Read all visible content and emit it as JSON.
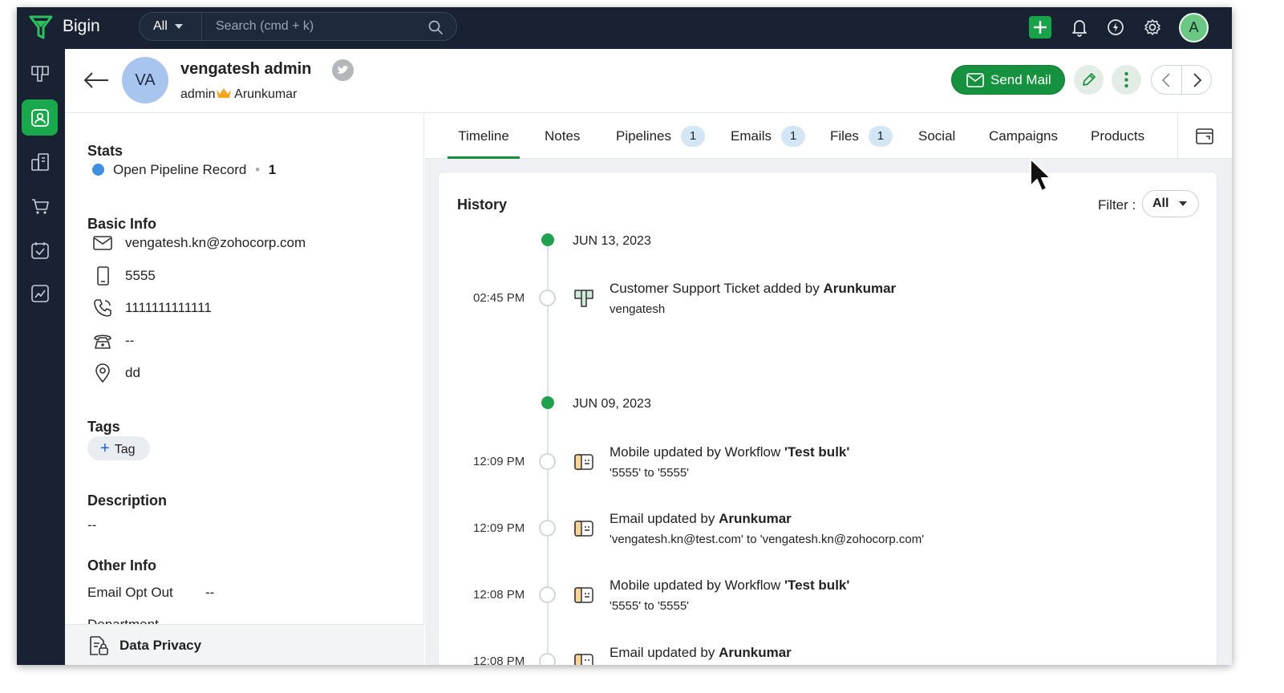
{
  "app": {
    "name": "Bigin"
  },
  "search": {
    "scope": "All",
    "placeholder": "Search (cmd + k)"
  },
  "topbar": {
    "avatar_letter": "A"
  },
  "contact": {
    "initials": "VA",
    "name": "vengatesh admin",
    "role": "admin",
    "owner": "Arunkumar"
  },
  "header": {
    "send_mail_label": "Send Mail"
  },
  "left_panel": {
    "stats_title": "Stats",
    "stats": {
      "label": "Open Pipeline Record",
      "separator": "•",
      "count": "1"
    },
    "basic_info_title": "Basic Info",
    "basic_info": {
      "email": "vengatesh.kn@zohocorp.com",
      "mobile": "5555",
      "phone": "1111111111111",
      "home_phone": "--",
      "address": "dd"
    },
    "tags_title": "Tags",
    "tag_button": "Tag",
    "description_title": "Description",
    "description_value": "--",
    "other_info_title": "Other Info",
    "other_info": [
      {
        "label": "Email Opt Out",
        "value": "--"
      },
      {
        "label": "Department",
        "value": "--"
      }
    ],
    "data_privacy": "Data Privacy"
  },
  "tabs": [
    {
      "label": "Timeline",
      "badge": null,
      "active": true
    },
    {
      "label": "Notes",
      "badge": null
    },
    {
      "label": "Pipelines",
      "badge": "1"
    },
    {
      "label": "Emails",
      "badge": "1"
    },
    {
      "label": "Files",
      "badge": "1"
    },
    {
      "label": "Social",
      "badge": null
    },
    {
      "label": "Campaigns",
      "badge": null
    },
    {
      "label": "Products",
      "badge": null
    }
  ],
  "history": {
    "title": "History",
    "filter_label": "Filter :",
    "filter_value": "All",
    "dates": [
      "JUN 13, 2023",
      "JUN 09, 2023"
    ],
    "events": [
      {
        "time": "02:45 PM",
        "title_prefix": "Customer Support Ticket added by ",
        "title_bold": "Arunkumar",
        "sub": "vengatesh"
      },
      {
        "time": "12:09 PM",
        "title_prefix": "Mobile updated by Workflow ",
        "title_bold": "'Test bulk'",
        "sub": "'5555' to '5555'"
      },
      {
        "time": "12:09 PM",
        "title_prefix": "Email updated by ",
        "title_bold": "Arunkumar",
        "sub": "'vengatesh.kn@test.com' to 'vengatesh.kn@zohocorp.com'"
      },
      {
        "time": "12:08 PM",
        "title_prefix": "Mobile updated by Workflow ",
        "title_bold": "'Test bulk'",
        "sub": "'5555' to '5555'"
      },
      {
        "time": "12:08 PM",
        "title_prefix": "Email updated by ",
        "title_bold": "Arunkumar",
        "sub": ""
      }
    ]
  },
  "colors": {
    "brand_green": "#15913f",
    "topbar": "#182232",
    "accent_blue": "#3f8fe0"
  }
}
